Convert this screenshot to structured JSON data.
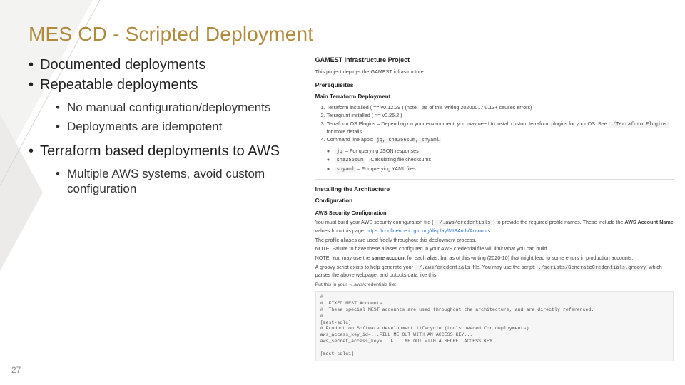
{
  "slide": {
    "title": "MES CD - Scripted Deployment",
    "page_number": "27",
    "bullets": {
      "b1": "Documented deployments",
      "b2": "Repeatable deployments",
      "b2_sub1": "No manual configuration/deployments",
      "b2_sub2": "Deployments are idempotent",
      "b3": "Terraform based deployments to AWS",
      "b3_sub1": "Multiple AWS systems, avoid custom configuration"
    }
  },
  "readme": {
    "h1": "GAMEST Infrastructure Project",
    "intro": "This project deploys the GAMEST infrastructure.",
    "prereq_h": "Prerequisites",
    "main_tf_h": "Main Terraform Deployment",
    "ol1": "Terraform installed ( == v0.12.29 ) (note – as of this writing 20200017 0.13+ causes errors)",
    "ol2": "Terragrunt installed ( >= v0.25.2 )",
    "ol3_a": "Terraform OS Plugins – Depending on your environment, you may need to install custom terraform plugins for your OS. See ",
    "ol3_code": "./Terraform Plugins",
    "ol3_b": " for more details.",
    "ol4_a": "Command line apps: ",
    "ol4_code": "jq, sha256sum, shyaml",
    "circ1_a": "jq",
    "circ1_b": " – For querying JSON responses",
    "circ2_a": "sha256sum",
    "circ2_b": " – Calculating file checksums",
    "circ3_a": "shyaml",
    "circ3_b": " – For querying YAML files",
    "install_h": "Installing the Architecture",
    "config_h": "Configuration",
    "aws_sec_h": "AWS Security Configuration",
    "p1_a": "You must build your AWS security configuration file ( ",
    "p1_code": "~/.aws/credentials",
    "p1_b": " ) to provide the required profile names. These include the ",
    "p1_c": "AWS Account Name",
    "p1_d": " values from this page: ",
    "p1_link": "https://confluence.ic.gtri.org/display/MISArch/Accounts",
    "p2": "The profile aliases are used freely throughout this deployment process.",
    "p3": "NOTE: Failure to have these aliases configured in your AWS credential file will limit what you can build.",
    "p4_a": "NOTE: You may use the ",
    "p4_b": "same account",
    "p4_c": " for each alias, but as of this writing (2020-10) that might lead to some errors in production accounts.",
    "p5_a": "A groovy script exists to help generate your ",
    "p5_code1": "~/.aws/credentials",
    "p5_b": " file. You may use the script: ",
    "p5_code2": "./scripts/GenerateCredentials.groovy",
    "p5_c": " which parses the above webpage, and outputs data like this:",
    "caption": "Put this in your ~/.aws/credentials file:",
    "codeblock": "#\n#  FIXED MEST Accounts\n#  These special MEST accounts are used throughout the architecture, and are directly referenced.\n#\n[mest-sdlc]\n# Production Software development lifecycle (tools needed for deployments)\naws_access_key_id=...FILL ME OUT WITH AN ACCESS KEY...\naws_secret_access_key=...FILL ME OUT WITH A SECRET ACCESS KEY...\n\n[mest-sdlc1]"
  }
}
